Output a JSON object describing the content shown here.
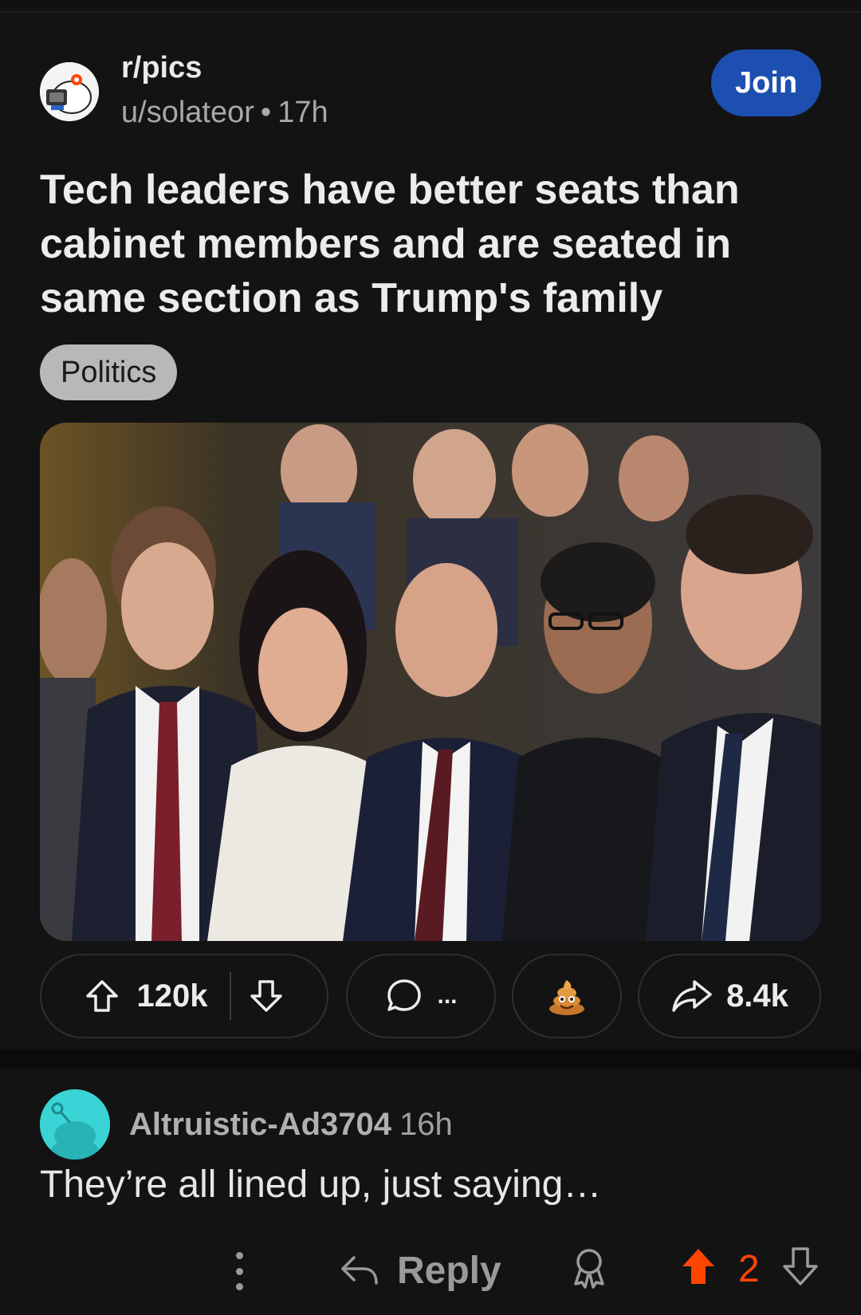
{
  "post": {
    "subreddit": "r/pics",
    "author": "u/solateor",
    "separator": "•",
    "age": "17h",
    "join_label": "Join",
    "title": "Tech leaders have better seats than cabinet members and are seated in same section as Trump's family",
    "flair": "Politics",
    "image_icon": "photo-of-group",
    "upvotes": "120k",
    "comments_label": "...",
    "award_icon": "poop-emoji-award",
    "shares": "8.4k"
  },
  "comment": {
    "username": "Altruistic-Ad3704",
    "age": "16h",
    "body": "They’re all lined up, just saying…",
    "reply_label": "Reply",
    "score": "2"
  },
  "colors": {
    "background": "#131314",
    "join_button": "#1d4fb0",
    "upvote_active": "#ff4500",
    "comment_avatar": "#3ad4d6"
  }
}
